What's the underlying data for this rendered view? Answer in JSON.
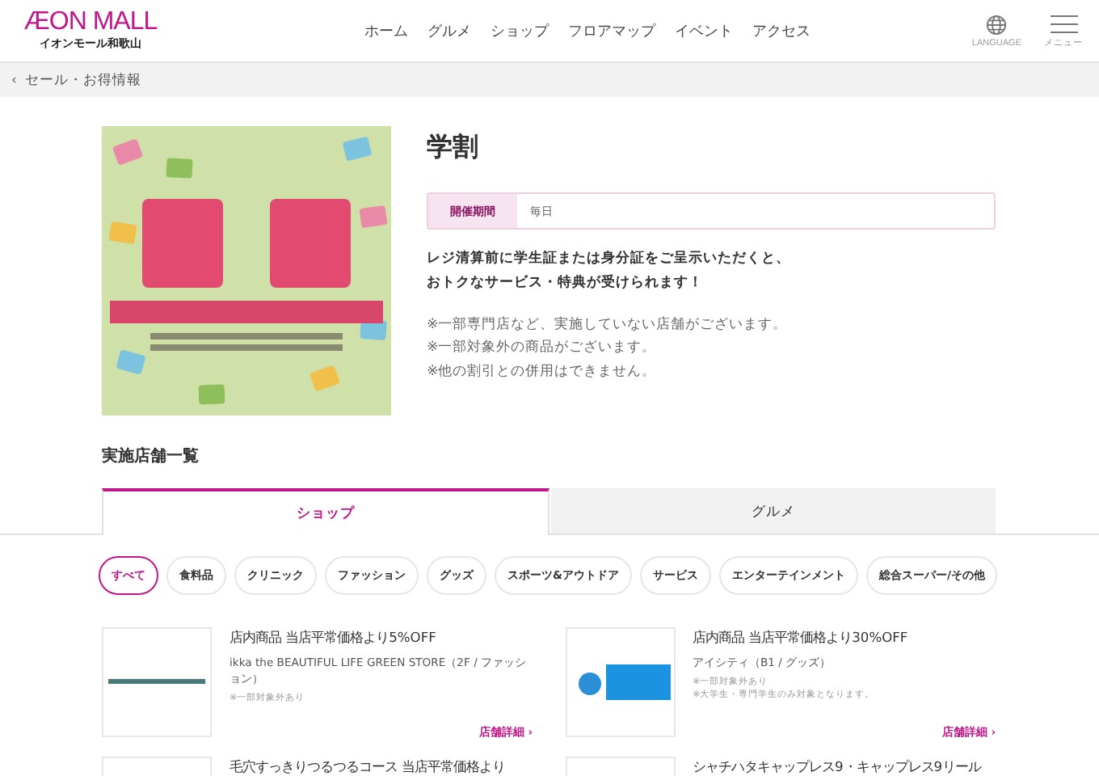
{
  "header": {
    "logo_main": "ÆON MALL",
    "logo_sub": "イオンモール和歌山",
    "nav": [
      "ホーム",
      "グルメ",
      "ショップ",
      "フロアマップ",
      "イベント",
      "アクセス"
    ],
    "language_label": "LANGUAGE",
    "menu_label": "メニュー"
  },
  "breadcrumb": {
    "back_icon": "‹",
    "label": "セール・お得情報"
  },
  "campaign": {
    "banner": {
      "kind": "picture"
    },
    "title": "学割",
    "period_label": "開催期間",
    "period_value": "毎日",
    "lead": [
      "レジ清算前に学生証または身分証をご呈示いただくと、",
      "おトクなサービス・特典が受けられます！"
    ],
    "notes": [
      "※一部専門店など、実施していない店舗がございます。",
      "※一部対象外の商品がございます。",
      "※他の割引との併用はできません。"
    ]
  },
  "section_title": "実施店舗一覧",
  "tabs": [
    {
      "label": "ショップ",
      "selected": true
    },
    {
      "label": "グルメ",
      "selected": false
    }
  ],
  "filters": [
    {
      "label": "すべて",
      "selected": true
    },
    {
      "label": "食料品",
      "selected": false
    },
    {
      "label": "クリニック",
      "selected": false
    },
    {
      "label": "ファッション",
      "selected": false
    },
    {
      "label": "グッズ",
      "selected": false
    },
    {
      "label": "スポーツ&アウトドア",
      "selected": false
    },
    {
      "label": "サービス",
      "selected": false
    },
    {
      "label": "エンターテインメント",
      "selected": false
    },
    {
      "label": "総合スーパー/その他",
      "selected": false
    }
  ],
  "shops": [
    {
      "offer": "店内商品 当店平常価格より5%OFF",
      "name": "ikka the BEAUTIFUL LIFE GREEN STORE",
      "location": "（2F / ファッション）",
      "notes": [
        "※一部対象外あり"
      ],
      "link": "店舗詳細 ›"
    },
    {
      "offer": "店内商品 当店平常価格より30%OFF",
      "name": "アイシティ",
      "location": "（B1 / グッズ）",
      "notes": [
        "※一部対象外あり",
        "※大学生・専門学生のみ対象となります。"
      ],
      "link": "店舗詳細 ›"
    },
    {
      "offer": "毛穴すっきりつるつるコース 当店平常価格より"
    },
    {
      "offer": "シャチハタキャップレス9・キャップレス9リール"
    }
  ]
}
